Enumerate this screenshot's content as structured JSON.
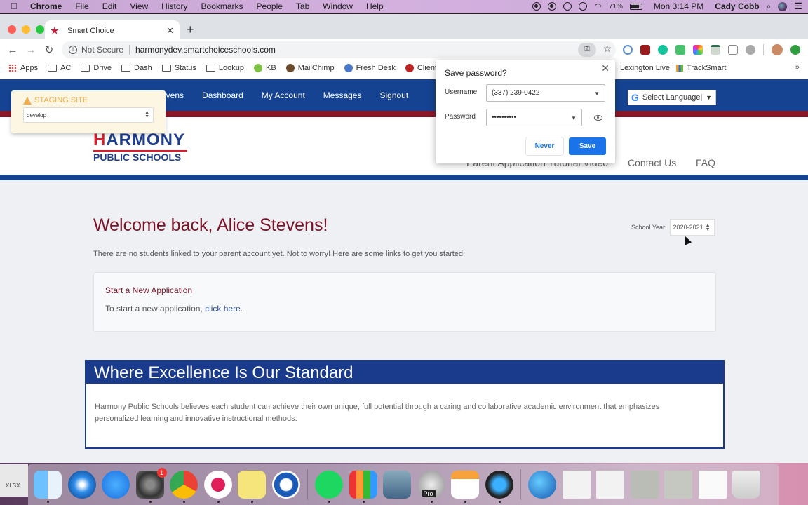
{
  "menubar": {
    "app": "Chrome",
    "items": [
      "File",
      "Edit",
      "View",
      "History",
      "Bookmarks",
      "People",
      "Tab",
      "Window",
      "Help"
    ],
    "battery": "71%",
    "clock": "Mon 3:14 PM",
    "user": "Cady Cobb"
  },
  "browser": {
    "tab_title": "Smart Choice",
    "not_secure": "Not Secure",
    "url": "harmonydev.smartchoiceschools.com",
    "bookmarks": [
      "Apps",
      "AC",
      "Drive",
      "Dash",
      "Status",
      "Lookup",
      "KB",
      "MailChimp",
      "Fresh Desk",
      "Client UR",
      "Lexington Live",
      "TrackSmart"
    ],
    "more": "»"
  },
  "site": {
    "nav": [
      "Alice Stevens",
      "Dashboard",
      "My Account",
      "Messages",
      "Signout"
    ],
    "nav_visible_fragment": "evens",
    "language_label": "Select Language",
    "logo_top": "ARMONY",
    "logo_h": "H",
    "logo_bottom": "PUBLIC SCHOOLS",
    "subnav": [
      "Parent Application Tutorial Video",
      "Contact Us",
      "FAQ"
    ],
    "staging": {
      "title": "STAGING SITE",
      "branch": "develop"
    },
    "welcome": "Welcome back, Alice Stevens!",
    "school_year_label": "School Year:",
    "school_year_value": "2020-2021",
    "intro": "There are no students linked to your parent account yet. Not to worry! Here are some links to get you started:",
    "card": {
      "title": "Start a New Application",
      "text": "To start a new application, ",
      "link": "click here",
      "after": "."
    },
    "excellence": {
      "heading": "Where Excellence Is Our Standard",
      "body": "Harmony Public Schools believes each student can achieve their own unique, full potential through a caring and collaborative academic environment that emphasizes personalized learning and innovative instructional methods."
    }
  },
  "password_bubble": {
    "title": "Save password?",
    "username_label": "Username",
    "username_value": "(337) 239-0422",
    "password_label": "Password",
    "password_value": "••••••••••",
    "never": "Never",
    "save": "Save"
  },
  "dock": {
    "apps": [
      "Finder",
      "Safari",
      "App Store",
      "System Preferences",
      "Chrome",
      "Slack",
      "Stickies",
      "1Password",
      "Spotify",
      "Numbers",
      "Preview",
      "Google Earth Pro",
      "Pages",
      "QuickTime",
      "Network Utility",
      "Numbers doc",
      "Numbers doc",
      "Photo doc",
      "Photo doc",
      "Screenshot",
      "Trash"
    ],
    "badge": "1",
    "pro_label": "Pro",
    "xlsx": "XLSX"
  },
  "colors": {
    "nav_blue": "#154391",
    "harmony_red": "#8b1628",
    "welcome_maroon": "#7a1328",
    "chrome_blue": "#1a73e8"
  }
}
